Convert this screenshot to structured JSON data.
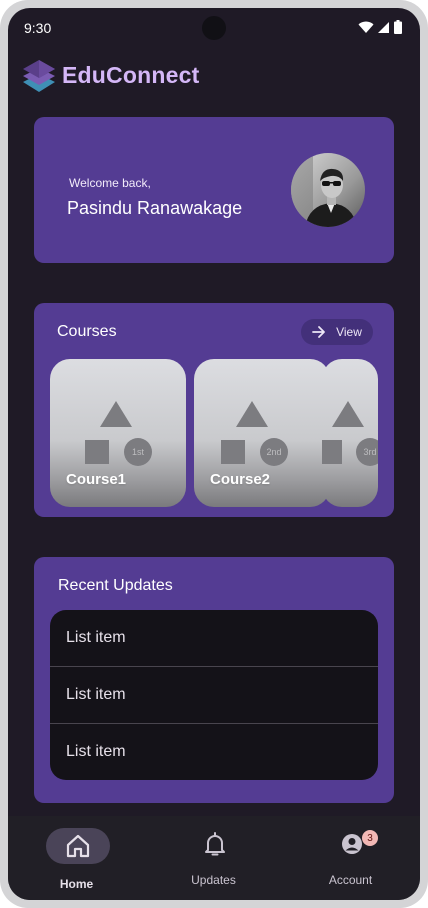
{
  "status_bar": {
    "time": "9:30",
    "icons": [
      "wifi-icon",
      "signal-icon",
      "battery-icon"
    ]
  },
  "header": {
    "app_name": "EduConnect",
    "logo_icon": "stacked-layers-logo"
  },
  "welcome": {
    "greeting": "Welcome back,",
    "user_name": "Pasindu Ranawakage"
  },
  "courses": {
    "title": "Courses",
    "view_label": "View",
    "view_icon": "arrow-right-icon",
    "items": [
      {
        "name": "Course1",
        "badge": "1st"
      },
      {
        "name": "Course2",
        "badge": "2nd"
      },
      {
        "name": "",
        "badge": "3rd"
      }
    ]
  },
  "updates": {
    "title": "Recent Updates",
    "items": [
      "List item",
      "List item",
      "List item"
    ]
  },
  "nav": {
    "items": [
      {
        "label": "Home",
        "icon": "home-icon",
        "active": true
      },
      {
        "label": "Updates",
        "icon": "bell-icon",
        "active": false
      },
      {
        "label": "Account",
        "icon": "account-icon",
        "active": false,
        "badge": "3"
      }
    ]
  },
  "colors": {
    "background": "#1f1a26",
    "card": "#543c93",
    "accent_text": "#d4b7f7",
    "list_bg": "#141218",
    "nav_bg": "#211f26"
  }
}
